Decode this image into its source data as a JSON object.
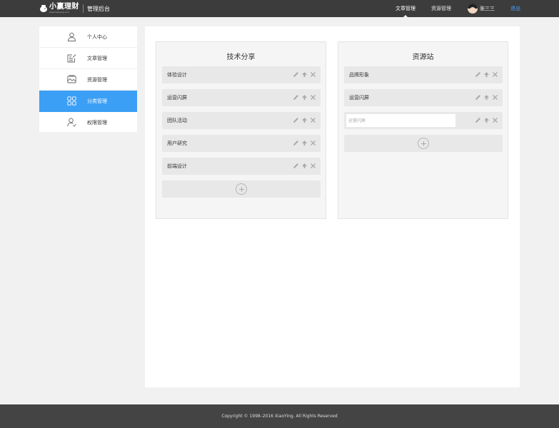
{
  "header": {
    "logo_text": "小赢理财",
    "logo_sub": "www.xiaoying.com",
    "admin_title": "管理后台",
    "nav": [
      {
        "label": "文章管理",
        "active": true
      },
      {
        "label": "资源管理",
        "active": false
      }
    ],
    "user_name": "张三三",
    "logout_label": "退出"
  },
  "sidebar": {
    "items": [
      {
        "label": "个人中心",
        "icon": "user-icon",
        "active": false
      },
      {
        "label": "文章管理",
        "icon": "article-edit-icon",
        "active": false
      },
      {
        "label": "资源管理",
        "icon": "resource-image-icon",
        "active": false
      },
      {
        "label": "分类管理",
        "icon": "category-grid-icon",
        "active": true
      },
      {
        "label": "权限管理",
        "icon": "user-permission-icon",
        "active": false
      }
    ]
  },
  "main": {
    "panels": [
      {
        "title": "技术分享",
        "items": [
          "体验设计",
          "运营闪屏",
          "团队活动",
          "用户研究",
          "前端设计"
        ]
      },
      {
        "title": "资源站",
        "items": [
          "品牌形象",
          "运营闪屏"
        ],
        "edit_input_placeholder": "运营闪屏"
      }
    ]
  },
  "footer": {
    "copyright": "Copyright © 1998–2016 XiaoYing. All Rights Reserved"
  },
  "colors": {
    "header_bg": "#3c3c3c",
    "accent": "#3b9ff5",
    "logout": "#4aa3ff",
    "footer_bg": "#444444",
    "row_bg": "#e8e8e8"
  }
}
